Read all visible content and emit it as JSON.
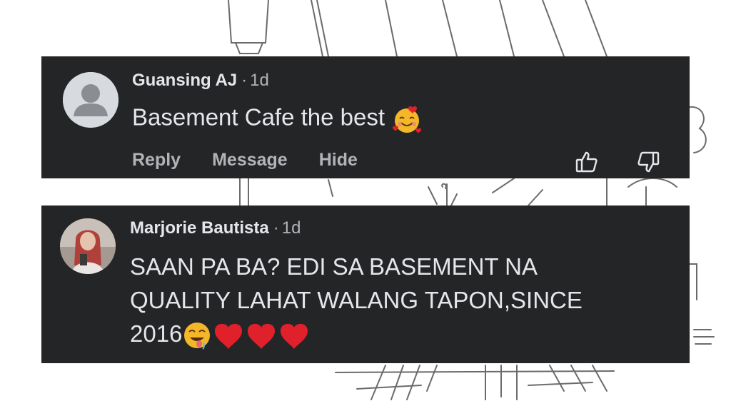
{
  "comments": [
    {
      "author": "Guansing AJ",
      "separator": "·",
      "time": "1d",
      "text": "Basement Cafe the best",
      "emoji": "smiling-face-with-hearts",
      "actions": {
        "reply": "Reply",
        "message": "Message",
        "hide": "Hide"
      },
      "icons": [
        "thumbs-up-icon",
        "thumbs-down-icon"
      ]
    },
    {
      "author": "Marjorie Bautista",
      "separator": "·",
      "time": "1d",
      "text_line1": "SAAN PA BA? EDI SA BASEMENT NA",
      "text_line2": "QUALITY LAHAT WALANG TAPON,SINCE",
      "text_line3": "2016",
      "emojis": [
        "drooling-face",
        "red-heart",
        "red-heart",
        "red-heart"
      ]
    }
  ],
  "colors": {
    "card_background": "#242526",
    "primary_text": "#e4e6eb",
    "secondary_text": "#b0b3b8",
    "heart_red": "#e0202a"
  }
}
